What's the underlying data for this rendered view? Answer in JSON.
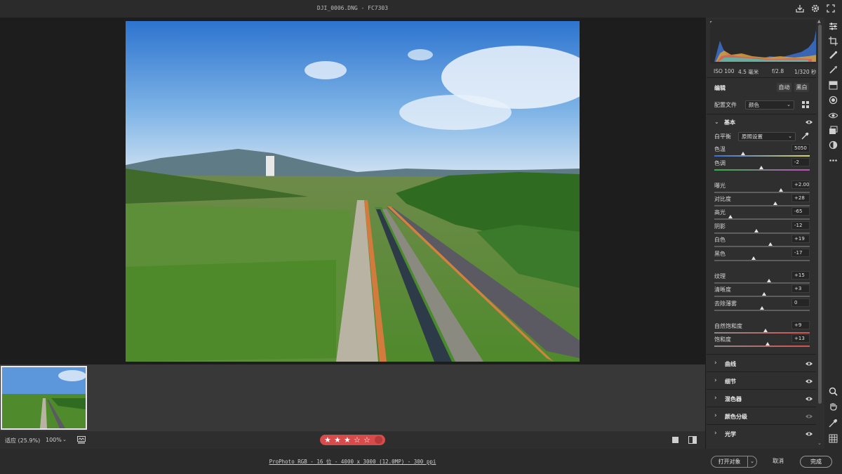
{
  "title": "DJI_0006.DNG -  FC7303",
  "zoom": {
    "fit_label": "适应 (25.9%)",
    "level": "100%"
  },
  "rating": {
    "stars": 3,
    "max": 5
  },
  "footer": {
    "metadata_link": "ProPhoto RGB - 16 位 - 4000 x 3000 (12.0MP) - 300 ppi",
    "open_button": "打开对象",
    "cancel_button": "取消",
    "done_button": "完成"
  },
  "camera_info": {
    "iso": "ISO 100",
    "focal": "4.5 毫米",
    "aperture": "f/2.8",
    "shutter": "1/320 秒"
  },
  "edit": {
    "header": "编辑",
    "auto_button": "自动",
    "bw_button": "黑白",
    "profile_label": "配置文件",
    "profile_value": "颜色"
  },
  "basic": {
    "title": "基本",
    "wb_label": "白平衡",
    "wb_value": "原照设置",
    "sliders": [
      {
        "label": "色温",
        "value": "5050",
        "pos": 0.3
      },
      {
        "label": "色调",
        "value": "-2",
        "pos": 0.49
      },
      {
        "label": "曝光",
        "value": "+2.00",
        "pos": 0.7
      },
      {
        "label": "对比度",
        "value": "+28",
        "pos": 0.64
      },
      {
        "label": "高光",
        "value": "-65",
        "pos": 0.17
      },
      {
        "label": "阴影",
        "value": "-12",
        "pos": 0.44
      },
      {
        "label": "白色",
        "value": "+19",
        "pos": 0.59
      },
      {
        "label": "黑色",
        "value": "-17",
        "pos": 0.41
      },
      {
        "label": "纹理",
        "value": "+15",
        "pos": 0.57
      },
      {
        "label": "清晰度",
        "value": "+3",
        "pos": 0.52
      },
      {
        "label": "去除薄雾",
        "value": "0",
        "pos": 0.5
      },
      {
        "label": "自然饱和度",
        "value": "+9",
        "pos": 0.54
      },
      {
        "label": "饱和度",
        "value": "+13",
        "pos": 0.56
      }
    ]
  },
  "sections": [
    "曲线",
    "细节",
    "混色器",
    "颜色分级",
    "光学"
  ],
  "colors": {
    "accent": "#d74b4b",
    "panel": "#2f2f2f",
    "canvas": "#1d1d1d"
  }
}
